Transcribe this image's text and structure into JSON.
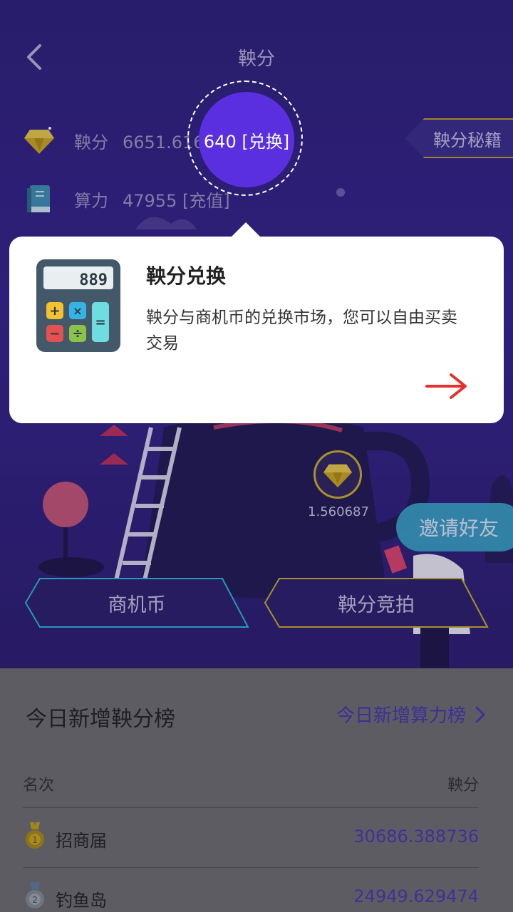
{
  "header": {
    "title": "鞅分"
  },
  "stats": {
    "score_label": "鞅分",
    "score_value": "6651.616640 [兑换]",
    "power_label": "算力",
    "power_value": "47955 [充值]"
  },
  "secret_button": "鞅分秘籍",
  "highlight": {
    "label": "640 [兑换]"
  },
  "tooltip": {
    "title": "鞅分兑换",
    "description": "鞅分与商机币的兑换市场，您可以自由买卖交易",
    "calculator_display": "889"
  },
  "coin": {
    "value": "1.560687"
  },
  "invite_button": "邀请好友",
  "tabs": [
    {
      "label": "商机币"
    },
    {
      "label": "鞅分竞拍"
    }
  ],
  "ranking": {
    "title": "今日新增鞅分榜",
    "link": "今日新增算力榜",
    "col_rank": "名次",
    "col_score": "鞅分",
    "rows": [
      {
        "name": "招商届",
        "value": "30686.388736"
      },
      {
        "name": "钓鱼岛",
        "value": "24949.629474"
      }
    ]
  },
  "colors": {
    "brand_purple": "#5a2fe0",
    "accent_gold": "#c9ae2c",
    "accent_red": "#e8312c",
    "ranking_value": "#3f3197"
  }
}
